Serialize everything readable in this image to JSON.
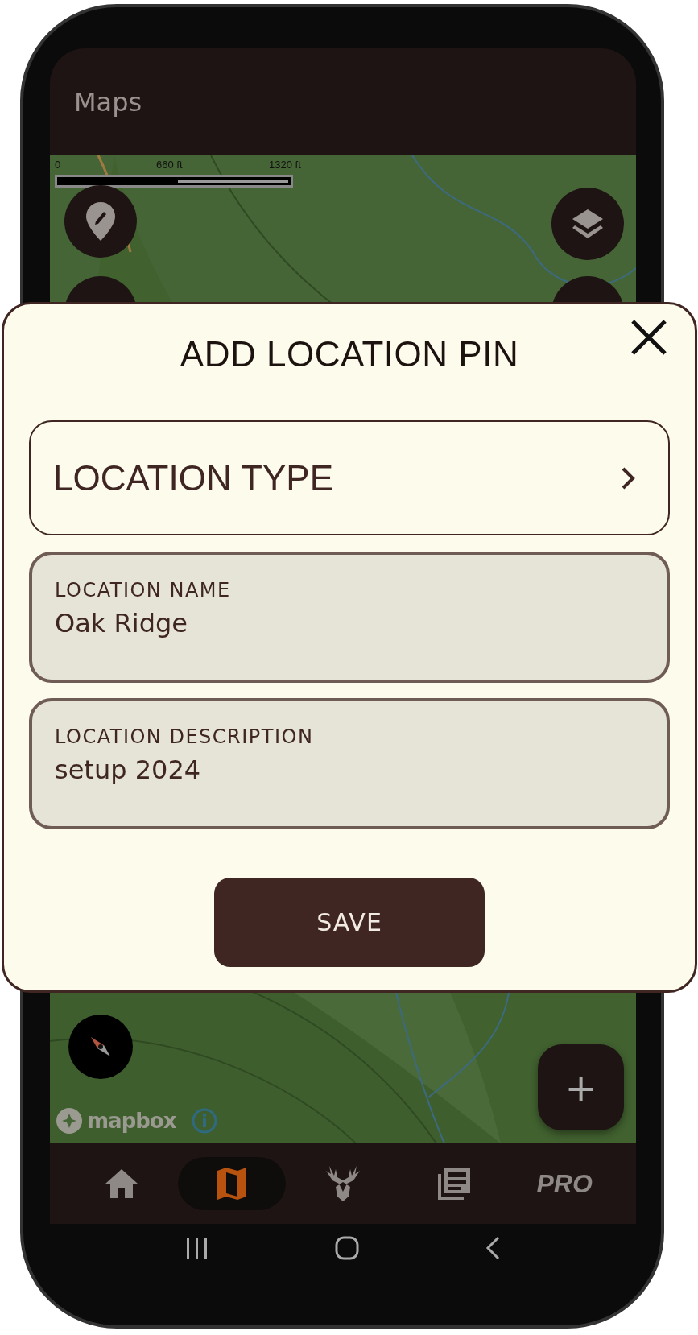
{
  "app_bar": {
    "title": "Maps"
  },
  "map": {
    "kind": "picture",
    "scale_labels": [
      "0",
      "660 ft",
      "1320 ft"
    ],
    "attribution": "mapbox",
    "add_button": "+"
  },
  "bottom_nav": [
    {
      "kind": "home",
      "selected": false
    },
    {
      "kind": "map",
      "selected": true
    },
    {
      "kind": "deer",
      "selected": false
    },
    {
      "kind": "news",
      "selected": false
    },
    {
      "kind": "text",
      "label": "PRO",
      "selected": false
    }
  ],
  "dialog": {
    "title": "ADD LOCATION PIN",
    "location_type": {
      "label": "LOCATION TYPE"
    },
    "fields": [
      {
        "label": "LOCATION NAME",
        "value": "Oak Ridge"
      },
      {
        "label": "LOCATION DESCRIPTION",
        "value": "setup 2024"
      }
    ],
    "save": "SAVE"
  }
}
